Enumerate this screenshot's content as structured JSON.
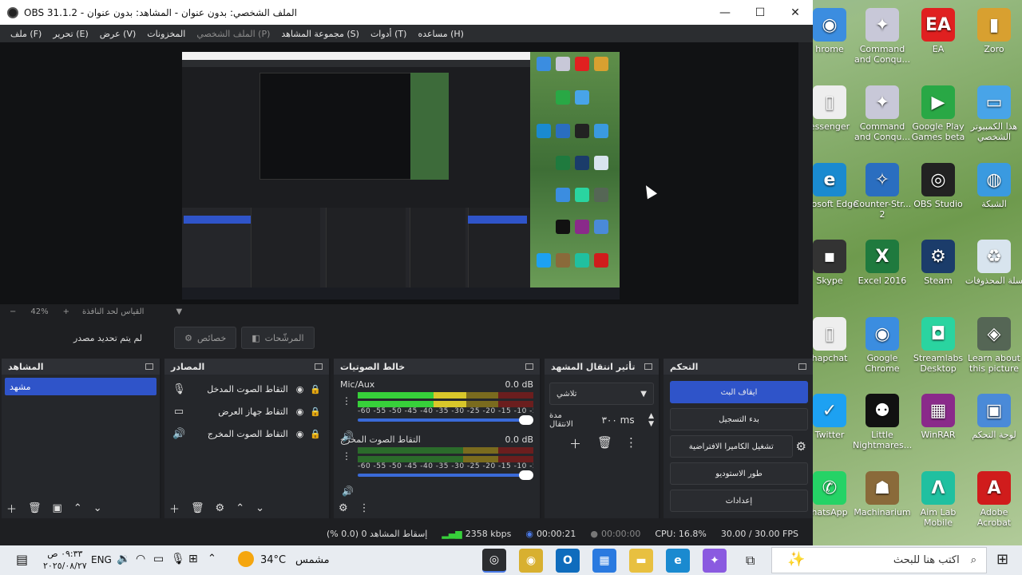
{
  "window": {
    "title": "OBS 31.1.2 - الملف الشخصي: بدون عنوان - المشاهد: بدون عنوان",
    "controls": {
      "minimize": "—",
      "maximize": "☐",
      "close": "✕"
    }
  },
  "menu": {
    "file": "ملف (F)",
    "edit": "تحرير (E)",
    "view": "عرض (V)",
    "docks": "المخزونات",
    "profile": "الملف الشخصي (P)",
    "scene_collection": "مجموعة المشاهد (S)",
    "tools": "أدوات (T)",
    "help": "مساعده (H)"
  },
  "zoom": {
    "minus": "−",
    "value": "42%",
    "plus": "+",
    "fit": "القياس لحد النافذة"
  },
  "source_bar": {
    "no_source": "لم يتم تحديد مصدر",
    "properties": "خصائص",
    "filters": "المرشّحات"
  },
  "scenes": {
    "title": "المشاهد",
    "items": [
      "مشهد"
    ]
  },
  "sources": {
    "title": "المصادر",
    "items": [
      {
        "icon": "microphone-icon",
        "label": "التقاط الصوت المدخل"
      },
      {
        "icon": "monitor-icon",
        "label": "التقاط جهاز العرض"
      },
      {
        "icon": "speaker-icon",
        "label": "التقاط الصوت المخرج"
      }
    ]
  },
  "mixer": {
    "title": "خالط الصوتيات",
    "ticks": "-60 -55 -50 -45 -40 -35 -30 -25 -20 -15 -10 -5 0",
    "channels": [
      {
        "name": "Mic/Aux",
        "db": "0.0 dB",
        "level": 0.62
      },
      {
        "name": "التقاط الصوت المخرج",
        "db": "0.0 dB",
        "level": 0.0
      }
    ]
  },
  "transitions": {
    "title": "تأثير انتقال المشهد",
    "type": "تلاشي",
    "duration_label": "مدة الانتقال",
    "duration_value": "٣٠٠ ms"
  },
  "controls": {
    "title": "التحكم",
    "stop_stream": "ايقاف البث",
    "start_recording": "بدء التسجيل",
    "virtual_camera": "تشغيل الكاميرا الافتراضية",
    "studio_mode": "طور الاستوديو",
    "settings": "إعدادات"
  },
  "status": {
    "dropped": "إسقاط المشاهد 0 (0.0 %)",
    "bitrate": "2358 kbps",
    "stream_time": "00:00:21",
    "rec_time": "00:00:00",
    "cpu": "CPU: 16.8%",
    "fps": "30.00 / 30.00 FPS"
  },
  "desktop_icons": [
    {
      "label": "EA",
      "color": "#e02020",
      "glyph": "EA"
    },
    {
      "label": "Zoro",
      "color": "#d8a030",
      "glyph": "▮"
    },
    {
      "label": "Command and Conqu...",
      "color": "#c8c8d8",
      "glyph": "✦"
    },
    {
      "label": "hrome",
      "color": "#3b8de0",
      "glyph": "◉"
    },
    {
      "label": "Command and Conqu...",
      "color": "#c8c8d8",
      "glyph": "✦"
    },
    {
      "label": "Google Play Games beta",
      "color": "#29a845",
      "glyph": "▶"
    },
    {
      "label": "هذا الكمبيوتر الشخصي",
      "color": "#48a4e8",
      "glyph": "▭"
    },
    {
      "label": "essenger",
      "color": "#eeeeee",
      "glyph": "▯"
    },
    {
      "label": "Counter-Str... 2",
      "color": "#2a6ec0",
      "glyph": "✧"
    },
    {
      "label": "OBS Studio",
      "color": "#222222",
      "glyph": "◎"
    },
    {
      "label": "الشبكة",
      "color": "#3a9ae0",
      "glyph": "◍"
    },
    {
      "label": "icrosoft Edge",
      "color": "#1a8ad0",
      "glyph": "e"
    },
    {
      "label": "Excel 2016",
      "color": "#1f7a3e",
      "glyph": "X"
    },
    {
      "label": "Steam",
      "color": "#1b3c6a",
      "glyph": "⚙"
    },
    {
      "label": "سلة المحذوفات",
      "color": "#d8e4ee",
      "glyph": "♻"
    },
    {
      "label": "Skype",
      "color": "#333333",
      "glyph": "▪"
    },
    {
      "label": "Google Chrome",
      "color": "#3b8de0",
      "glyph": "◉"
    },
    {
      "label": "Streamlabs Desktop",
      "color": "#2ad4a0",
      "glyph": "◘"
    },
    {
      "label": "Learn about this picture",
      "color": "#556655",
      "glyph": "◈"
    },
    {
      "label": "hapchat",
      "color": "#eeeeee",
      "glyph": "▯"
    },
    {
      "label": "Little Nightmares...",
      "color": "#111111",
      "glyph": "⚉"
    },
    {
      "label": "WinRAR",
      "color": "#8a2a8a",
      "glyph": "▦"
    },
    {
      "label": "لوحة التحكم",
      "color": "#4a8ad8",
      "glyph": "▣"
    },
    {
      "label": "Twitter",
      "color": "#1da1f2",
      "glyph": "✓"
    },
    {
      "label": "Machinarium",
      "color": "#8a6a3a",
      "glyph": "☗"
    },
    {
      "label": "Aim Lab Mobile",
      "color": "#20c0a0",
      "glyph": "Λ"
    },
    {
      "label": "Adobe Acrobat",
      "color": "#d01c1c",
      "glyph": "A"
    },
    {
      "label": "hatsApp",
      "color": "#25d366",
      "glyph": "✆"
    }
  ],
  "taskbar": {
    "search_placeholder": "اكتب هنا للبحث",
    "weather_temp": "34°C",
    "weather_label": "مشمس",
    "language": "ENG",
    "time": "٠٩:٣٣ ص",
    "date": "٢٠٢٥/٠٨/٢٧"
  }
}
